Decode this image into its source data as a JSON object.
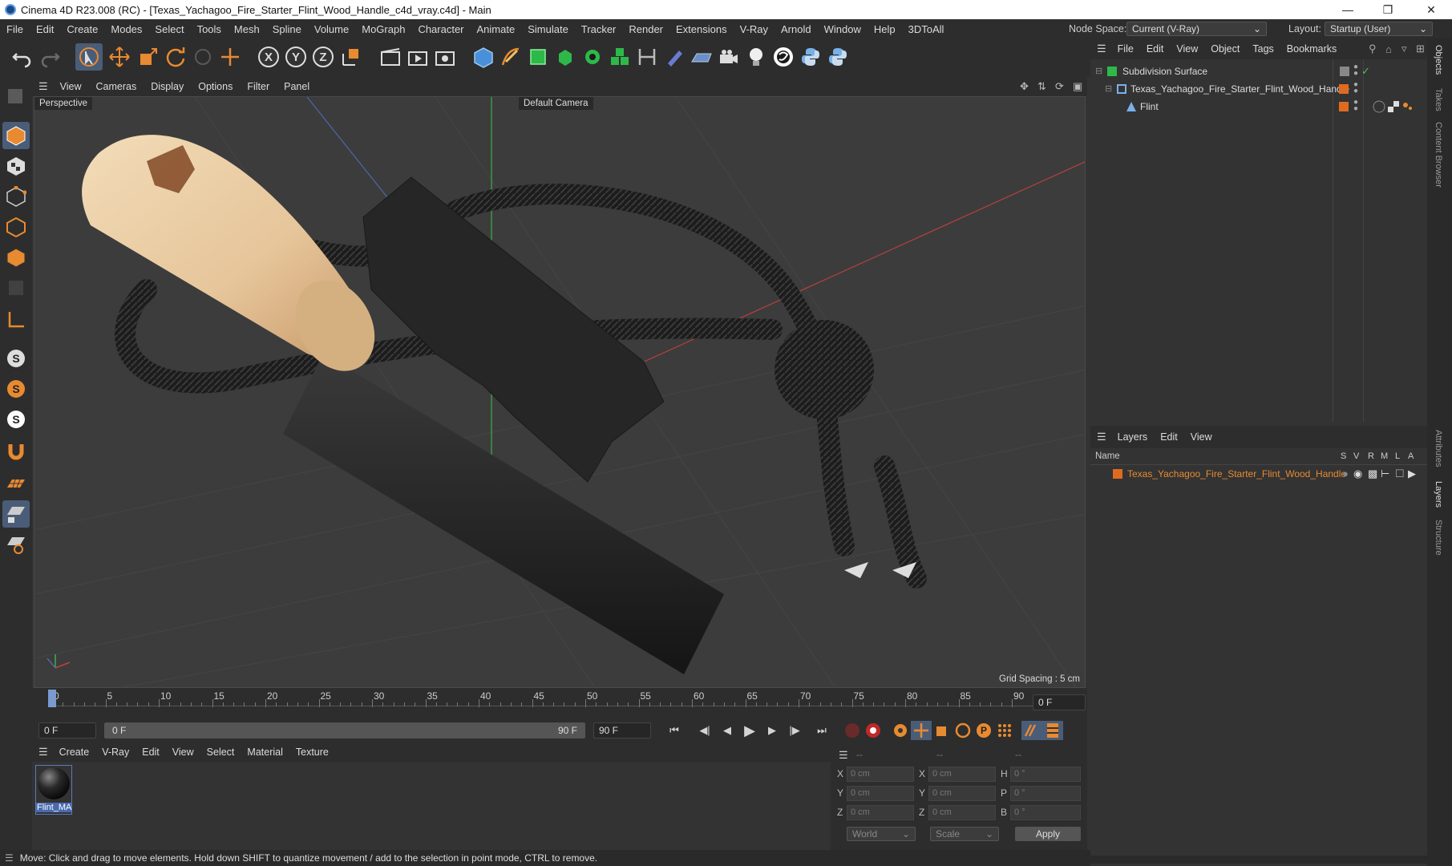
{
  "window": {
    "title": "Cinema 4D R23.008 (RC) - [Texas_Yachagoo_Fire_Starter_Flint_Wood_Handle_c4d_vray.c4d] - Main"
  },
  "menubar": {
    "items": [
      "File",
      "Edit",
      "Create",
      "Modes",
      "Select",
      "Tools",
      "Mesh",
      "Spline",
      "Volume",
      "MoGraph",
      "Character",
      "Animate",
      "Simulate",
      "Tracker",
      "Render",
      "Extensions",
      "V-Ray",
      "Arnold",
      "Window",
      "Help",
      "3DToAll"
    ],
    "node_space_label": "Node Space:",
    "node_space_value": "Current (V-Ray)",
    "layout_label": "Layout:",
    "layout_value": "Startup (User)"
  },
  "viewport": {
    "menu": [
      "View",
      "Cameras",
      "Display",
      "Options",
      "Filter",
      "Panel"
    ],
    "view_name": "Perspective",
    "camera_name": "Default Camera",
    "grid_spacing": "Grid Spacing : 5 cm"
  },
  "timeline": {
    "ticks": [
      "0",
      "5",
      "10",
      "15",
      "20",
      "25",
      "30",
      "35",
      "40",
      "45",
      "50",
      "55",
      "60",
      "65",
      "70",
      "75",
      "80",
      "85",
      "90"
    ],
    "current_frame": "0 F",
    "start_frame": "0 F",
    "range_start": "0 F",
    "range_end": "90 F",
    "end_frame": "90 F"
  },
  "material_manager": {
    "menu": [
      "Create",
      "V-Ray",
      "Edit",
      "View",
      "Select",
      "Material",
      "Texture"
    ],
    "materials": [
      {
        "name": "Flint_MA"
      }
    ]
  },
  "coords": {
    "header_a": "--",
    "header_b": "--",
    "header_c": "--",
    "rows": [
      {
        "l1": "X",
        "v1": "0 cm",
        "l2": "X",
        "v2": "0 cm",
        "l3": "H",
        "v3": "0 °"
      },
      {
        "l1": "Y",
        "v1": "0 cm",
        "l2": "Y",
        "v2": "0 cm",
        "l3": "P",
        "v3": "0 °"
      },
      {
        "l1": "Z",
        "v1": "0 cm",
        "l2": "Z",
        "v2": "0 cm",
        "l3": "B",
        "v3": "0 °"
      }
    ],
    "coord_system": "World",
    "mode": "Scale",
    "apply_label": "Apply"
  },
  "objects_panel": {
    "menu": [
      "File",
      "Edit",
      "View",
      "Object",
      "Tags",
      "Bookmarks"
    ],
    "items": [
      {
        "name": "Subdivision Surface"
      },
      {
        "name": "Texas_Yachagoo_Fire_Starter_Flint_Wood_Handle"
      },
      {
        "name": "Flint"
      }
    ]
  },
  "layers_panel": {
    "menu": [
      "Layers",
      "Edit",
      "View"
    ],
    "col_name": "Name",
    "cols": [
      "S",
      "V",
      "R",
      "M",
      "L",
      "A"
    ],
    "layer_name": "Texas_Yachagoo_Fire_Starter_Flint_Wood_Handle"
  },
  "side_tabs": [
    "Objects",
    "Takes",
    "Content Browser",
    "Attributes",
    "Layers",
    "Structure"
  ],
  "status": "Move: Click and drag to move elements. Hold down SHIFT to quantize movement / add to the selection in point mode, CTRL to remove.",
  "colors": {
    "accent": "#e88a30",
    "selection": "#4a5d78",
    "background": "#333333"
  }
}
